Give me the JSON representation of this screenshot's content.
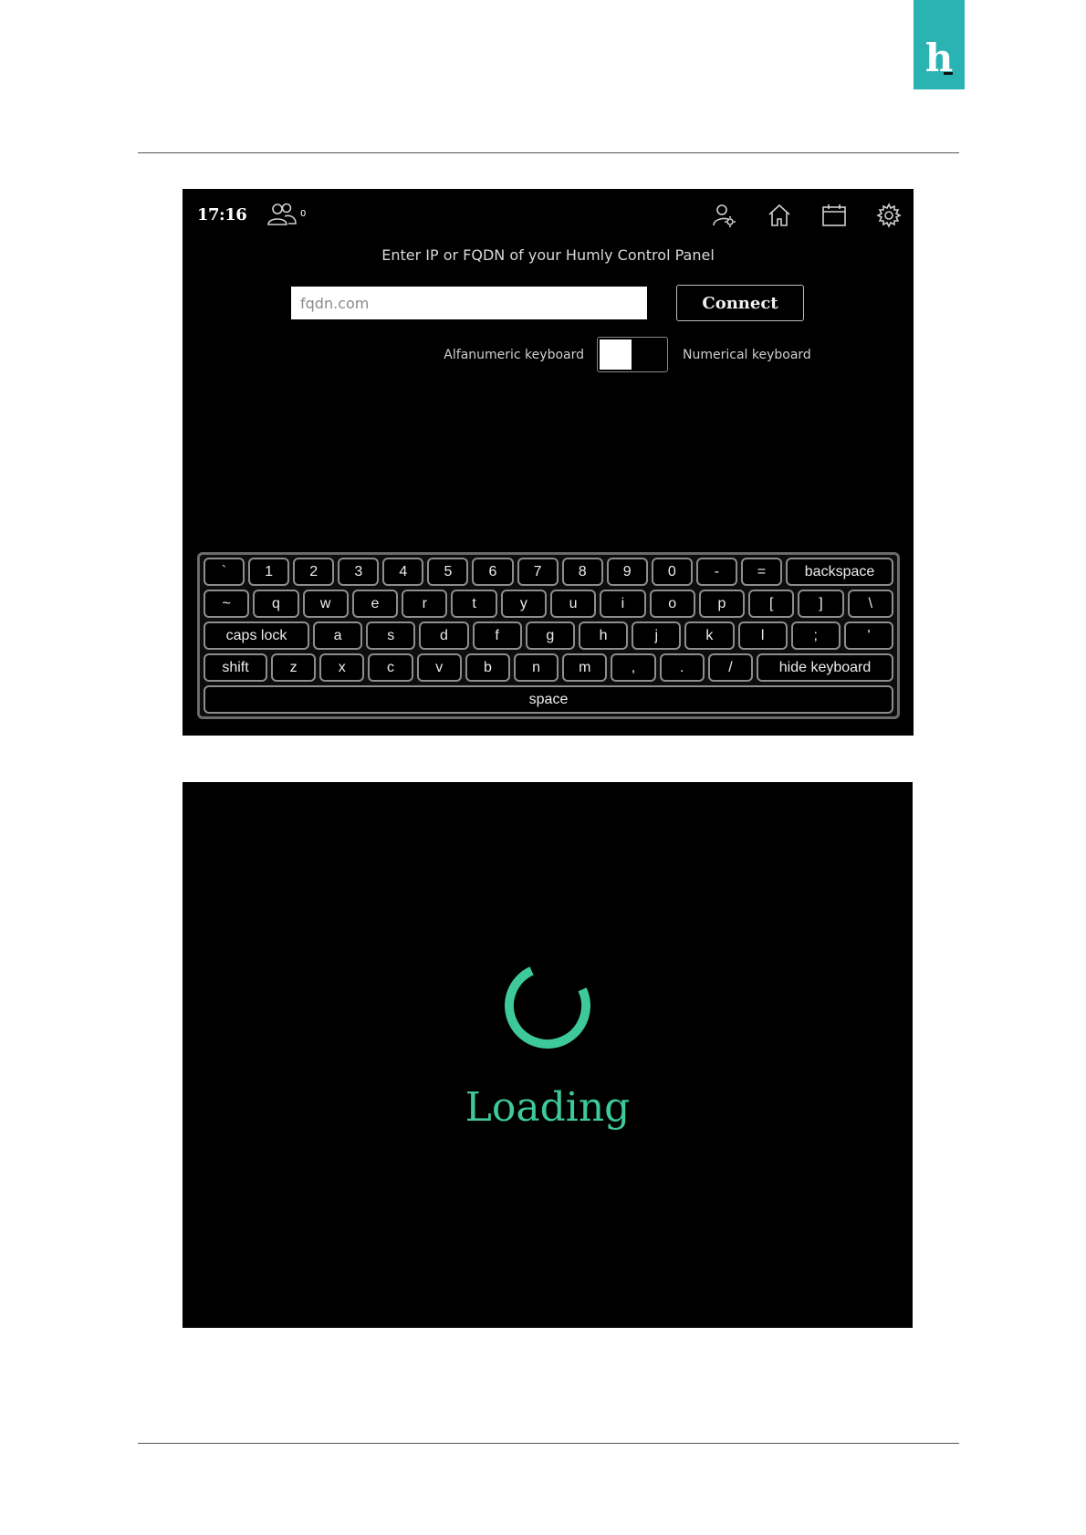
{
  "logo": {
    "letter": "h",
    "color": "#2ab3b3"
  },
  "screen1": {
    "status_bar": {
      "time": "17:16",
      "people_count": "0",
      "icons": [
        "people-icon",
        "user-settings-icon",
        "home-icon",
        "calendar-icon",
        "gear-icon"
      ]
    },
    "prompt": "Enter IP or FQDN of your Humly Control Panel",
    "address_input": {
      "value": "",
      "placeholder": "fqdn.com"
    },
    "connect_label": "Connect",
    "keyboard_toggle": {
      "left_label": "Alfanumeric keyboard",
      "right_label": "Numerical keyboard",
      "selected": "Alfanumeric keyboard"
    },
    "keyboard": {
      "rows": [
        [
          "`",
          "1",
          "2",
          "3",
          "4",
          "5",
          "6",
          "7",
          "8",
          "9",
          "0",
          "-",
          "=",
          "backspace"
        ],
        [
          "~",
          "q",
          "w",
          "e",
          "r",
          "t",
          "y",
          "u",
          "i",
          "o",
          "p",
          "[",
          "]",
          "\\"
        ],
        [
          "caps lock",
          "a",
          "s",
          "d",
          "f",
          "g",
          "h",
          "j",
          "k",
          "l",
          ";",
          "'"
        ],
        [
          "shift",
          "z",
          "x",
          "c",
          "v",
          "b",
          "n",
          "m",
          ",",
          ".",
          "/",
          "hide keyboard"
        ],
        [
          "space"
        ]
      ]
    }
  },
  "screen2": {
    "loading_text": "Loading",
    "accent_color": "#3ec99b"
  }
}
